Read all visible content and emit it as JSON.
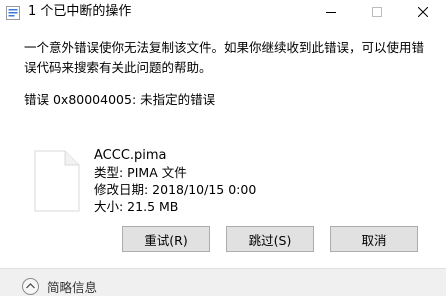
{
  "window": {
    "title": "1 个已中断的操作",
    "controls": {
      "minimize_icon": "minimize-icon",
      "maximize_icon": "maximize-icon",
      "close_icon": "close-icon"
    }
  },
  "dialog": {
    "message": "一个意外错误使你无法复制该文件。如果你继续收到此错误，可以使用错\n误代码来搜索有关此问题的帮助。",
    "error_code": "错误 0x80004005: 未指定的错误"
  },
  "file": {
    "icon": "blank-file-icon",
    "name": "ACCC.pima",
    "type": "类型: PIMA 文件",
    "modified": "修改日期: 2018/10/15 0:00",
    "size": "大小: 21.5 MB"
  },
  "buttons": {
    "retry": "重试(R)",
    "skip": "跳过(S)",
    "cancel": "取消"
  },
  "footer": {
    "details_label": "简略信息",
    "details_icon": "chevron-up-icon"
  },
  "colors": {
    "button_bg": "#e1e1e1",
    "button_border": "#adadad",
    "footer_bg": "#f0f0f0"
  }
}
